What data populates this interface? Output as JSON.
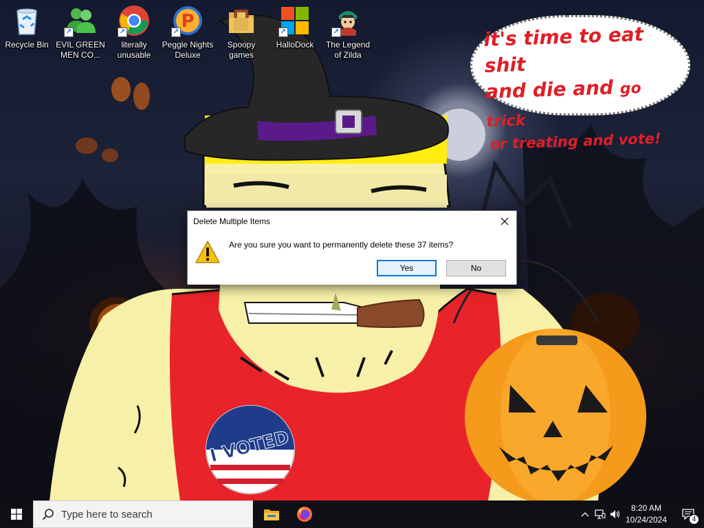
{
  "desktop": {
    "icons": [
      {
        "label": "Recycle Bin",
        "icon": "recycle-bin-icon",
        "shortcut": false
      },
      {
        "label": "EVIL GREEN\nMEN CO...",
        "icon": "green-people-icon",
        "shortcut": true
      },
      {
        "label": "literally\nunusable",
        "icon": "chrome-icon",
        "shortcut": true
      },
      {
        "label": "Peggle Nights\nDeluxe",
        "icon": "peggle-icon",
        "shortcut": true
      },
      {
        "label": "Spoopy\ngames",
        "icon": "folder-icon",
        "shortcut": false
      },
      {
        "label": "HalloDock",
        "icon": "windows-logo-icon",
        "shortcut": true
      },
      {
        "label": "The Legend\nof Zilda",
        "icon": "game-character-icon",
        "shortcut": true
      }
    ]
  },
  "wallpaper": {
    "bubble": {
      "line1": "it's time to eat shit",
      "line2_big": "and die and",
      "line2_small": "go trick",
      "line3": "or treating and vote!"
    },
    "sticker": "I VOTED",
    "colors": {
      "bubble_text": "#e01e26",
      "shirt": "#e8242a",
      "skin": "#f7f0a8",
      "pumpkin": "#f59a1b"
    }
  },
  "dialog": {
    "title": "Delete Multiple Items",
    "message": "Are you sure you want to permanently delete these 37 items?",
    "yes_label": "Yes",
    "no_label": "No",
    "icon": "warning-icon"
  },
  "taskbar": {
    "search_placeholder": "Type here to search",
    "apps": [
      "file-explorer-icon",
      "firefox-icon"
    ],
    "tray_icons": [
      "chevron-up-icon",
      "network-icon",
      "volume-icon"
    ],
    "time": "8:20 AM",
    "date": "10/24/2024",
    "notification_count": "4",
    "accent": "#0078d7"
  }
}
